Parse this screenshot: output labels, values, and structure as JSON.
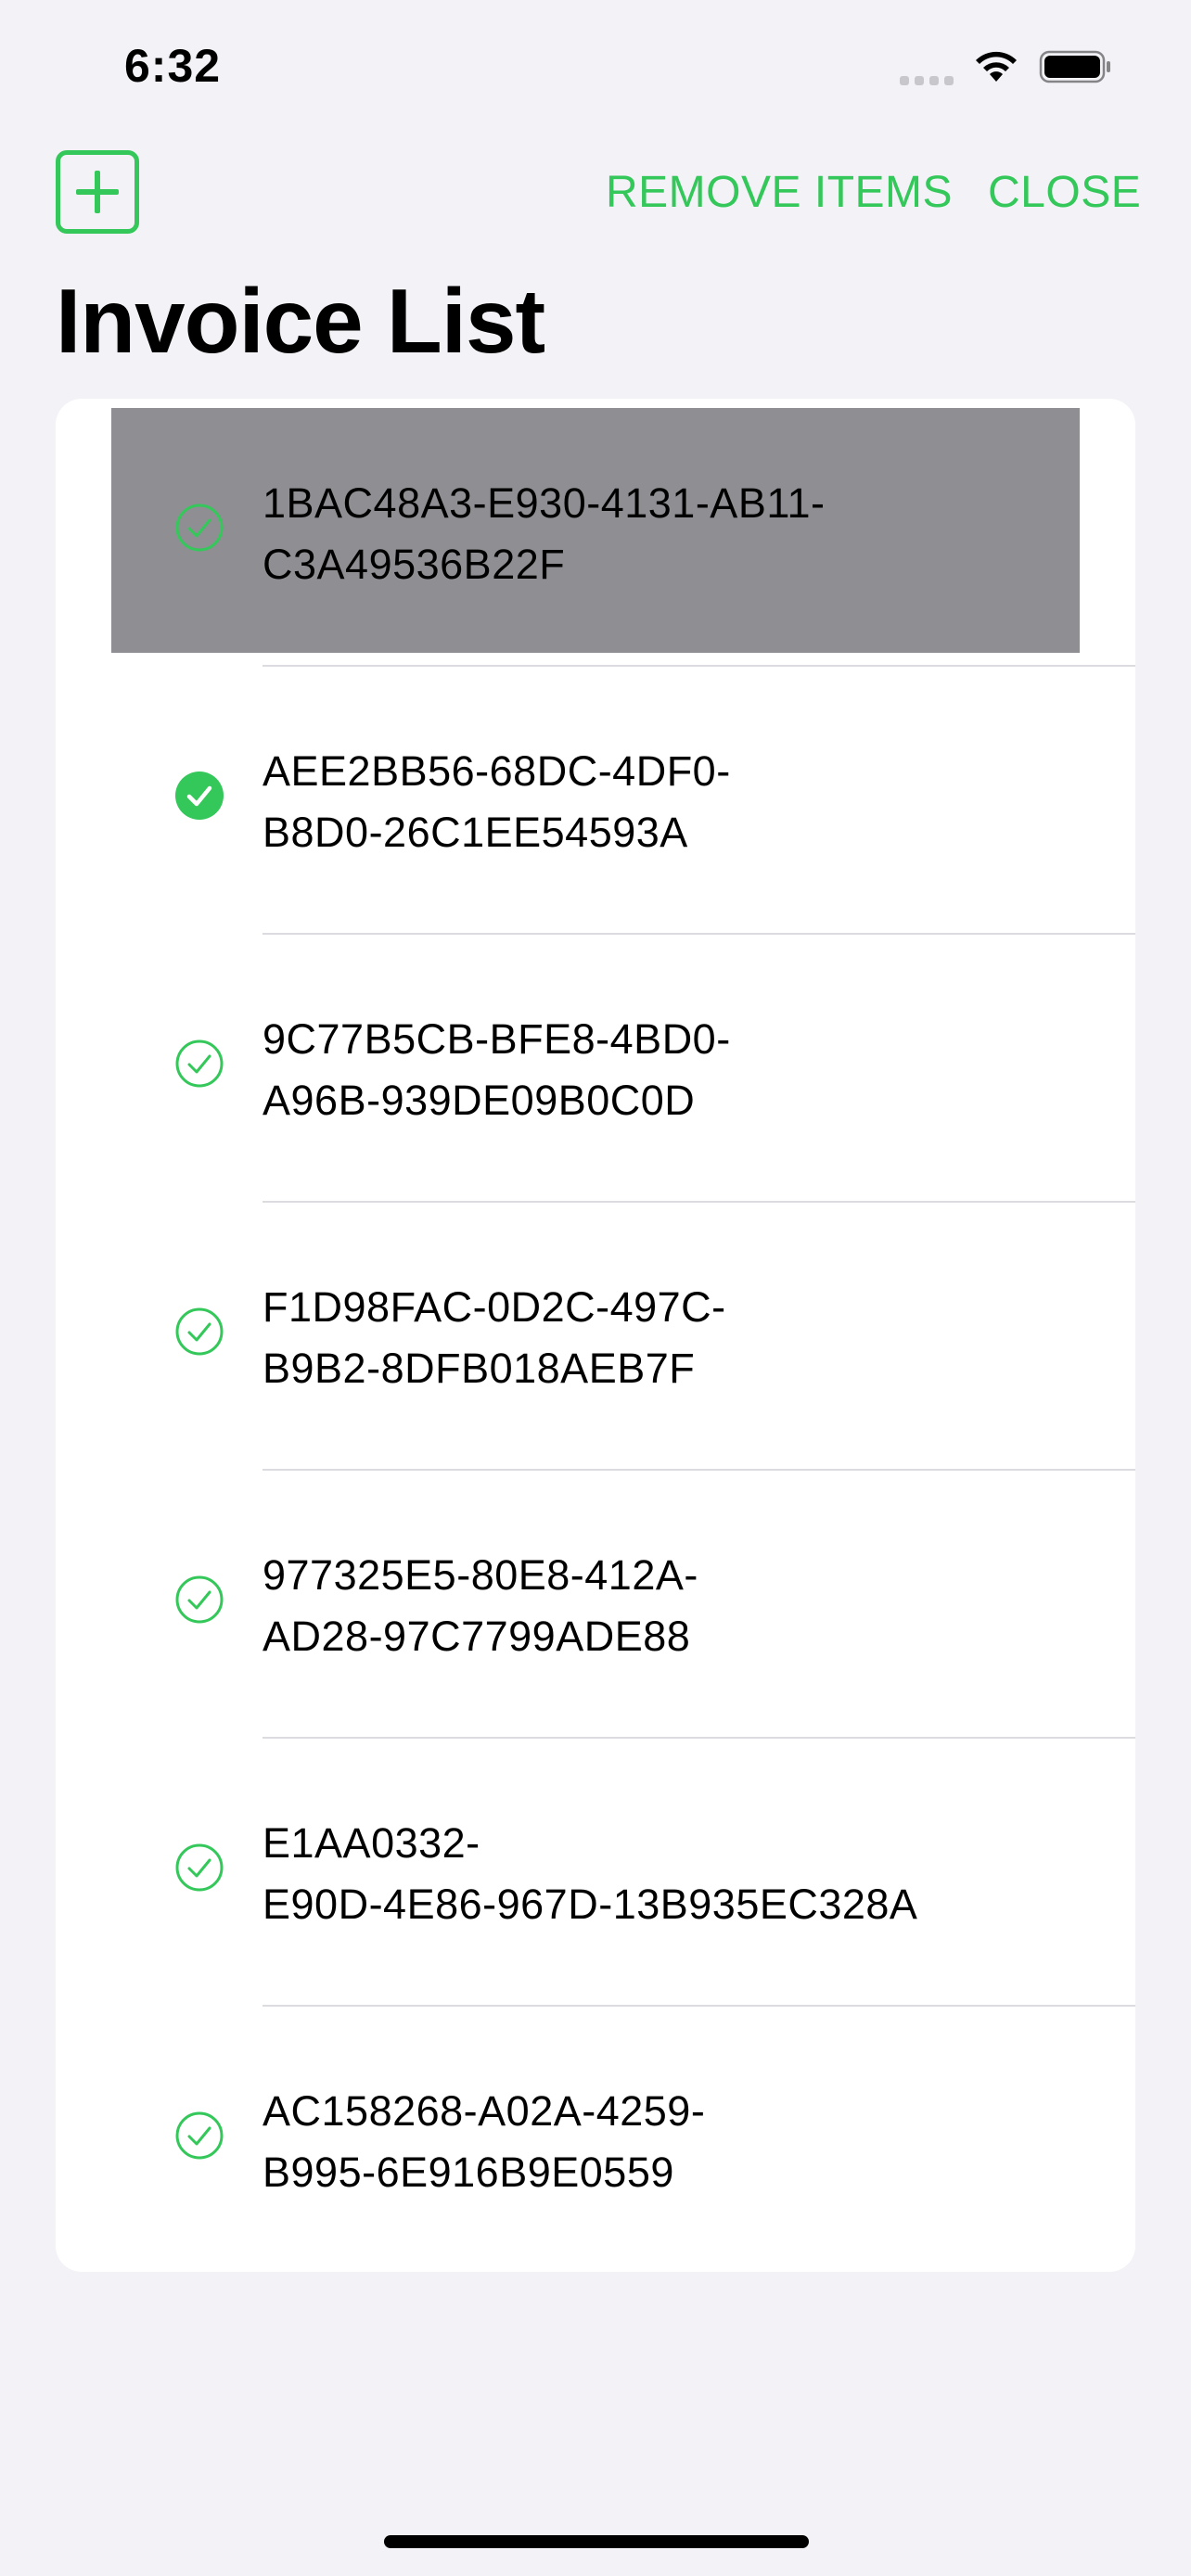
{
  "status_bar": {
    "time": "6:32",
    "signal_icon": "cellular-signal-icon",
    "wifi_icon": "wifi-icon",
    "battery_icon": "battery-icon"
  },
  "nav": {
    "add_icon": "plus-square-icon",
    "remove_label": "REMOVE ITEMS",
    "close_label": "CLOSE",
    "accent_color": "#34c759"
  },
  "title": "Invoice List",
  "invoices": [
    {
      "id": "1BAC48A3-E930-4131-AB11-\nC3A49536B22F",
      "filled": false,
      "selected": true
    },
    {
      "id": "AEE2BB56-68DC-4DF0-\nB8D0-26C1EE54593A",
      "filled": true,
      "selected": false
    },
    {
      "id": "9C77B5CB-BFE8-4BD0-\nA96B-939DE09B0C0D",
      "filled": false,
      "selected": false
    },
    {
      "id": "F1D98FAC-0D2C-497C-\nB9B2-8DFB018AEB7F",
      "filled": false,
      "selected": false
    },
    {
      "id": "977325E5-80E8-412A-\nAD28-97C7799ADE88",
      "filled": false,
      "selected": false
    },
    {
      "id": "E1AA0332-\nE90D-4E86-967D-13B935EC328A",
      "filled": false,
      "selected": false
    },
    {
      "id": "AC158268-A02A-4259-\nB995-6E916B9E0559",
      "filled": false,
      "selected": false
    }
  ],
  "colors": {
    "background": "#f2f2f7",
    "selection": "#8e8e93",
    "check_green": "#34c759"
  }
}
